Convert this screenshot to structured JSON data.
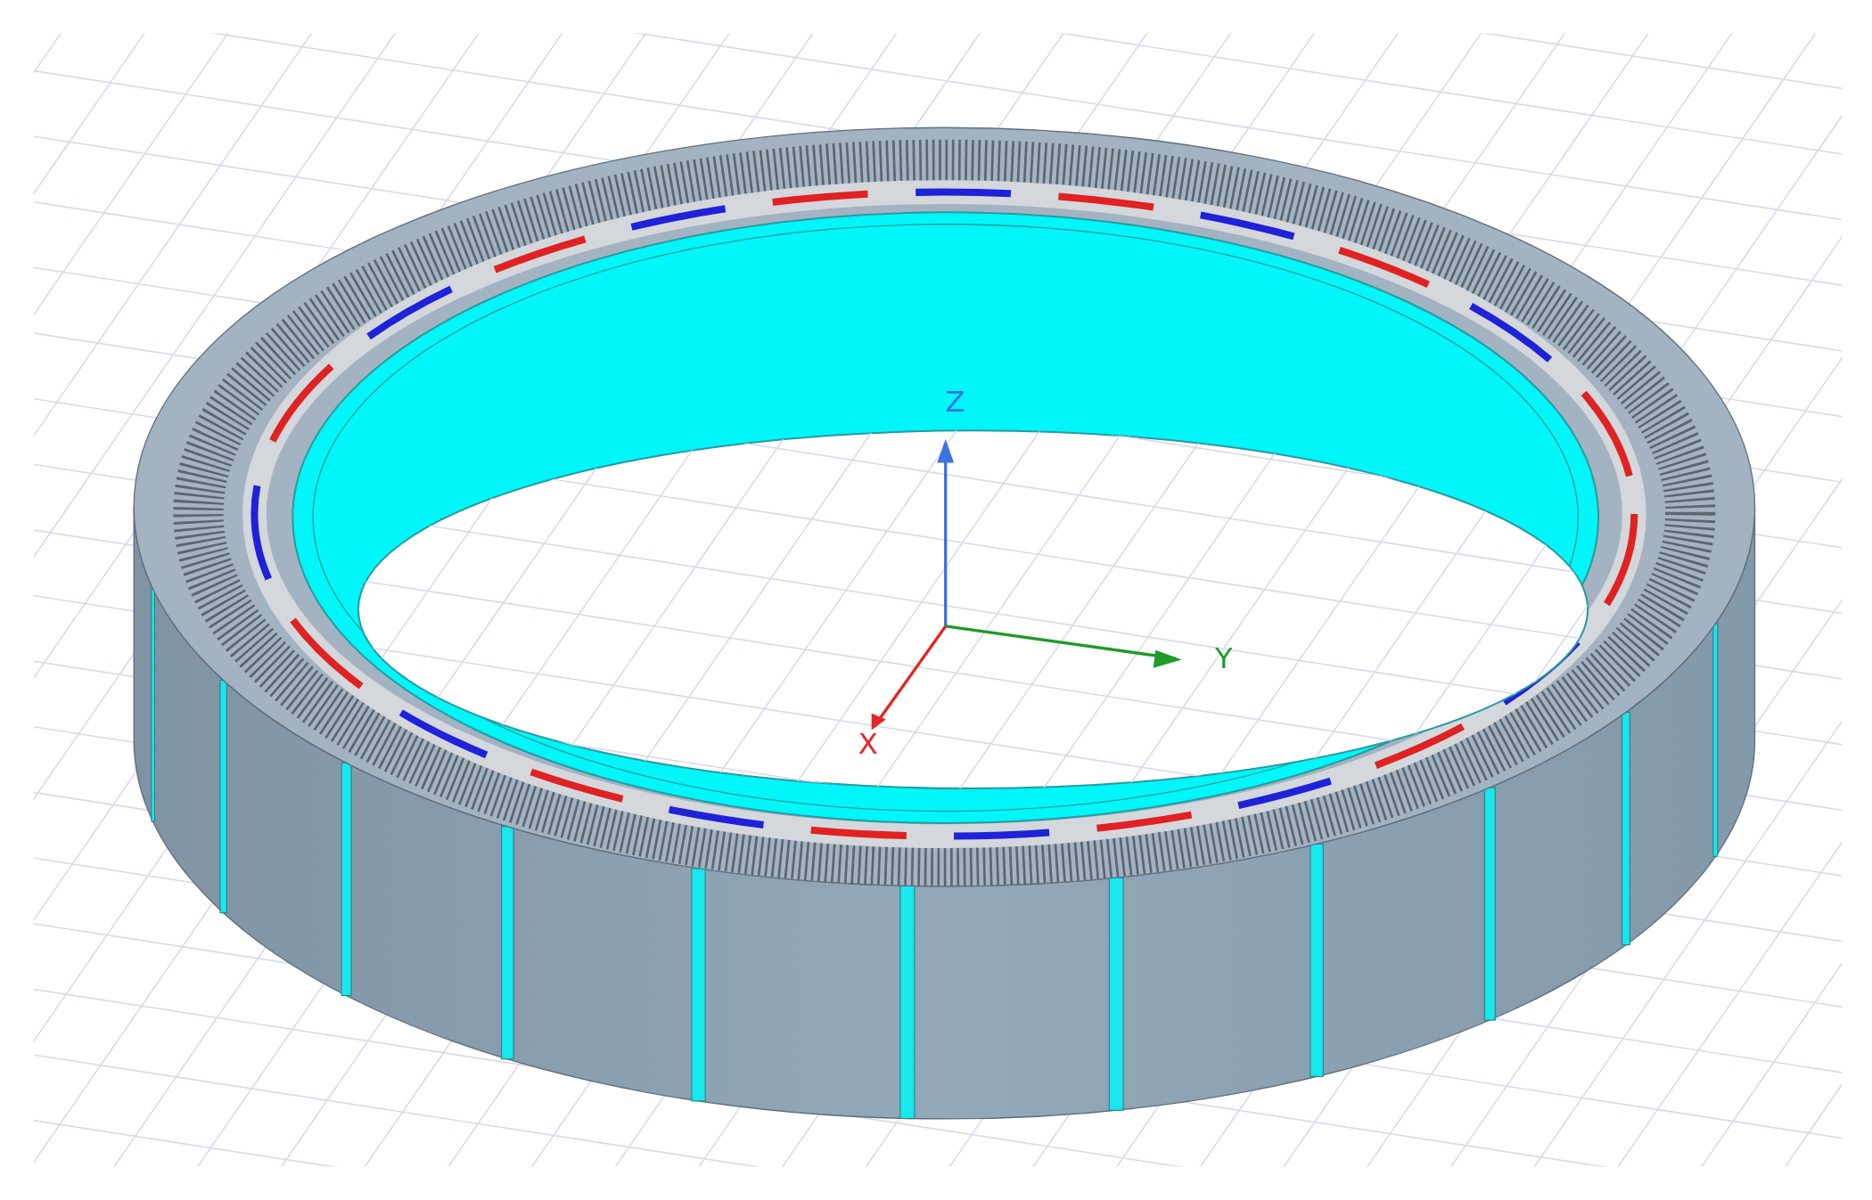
{
  "axes": [
    {
      "label": "Z",
      "color": "#3b73e0"
    },
    {
      "label": "Y",
      "color": "#1f9a2a"
    },
    {
      "label": "X",
      "color": "#e42626"
    }
  ]
}
